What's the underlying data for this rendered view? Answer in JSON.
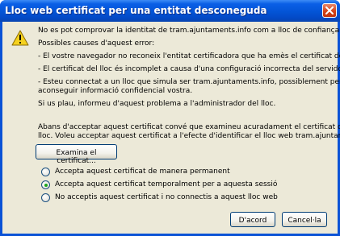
{
  "window": {
    "title": "Lloc web certificat per una entitat desconeguda"
  },
  "message": {
    "line1": "No es pot comprovar la identitat de tram.ajuntaments.info com a lloc de confiança.",
    "causes_heading": "Possibles causes d'aquest error:",
    "cause1": "- El vostre navegador no reconeix l'entitat certificadora que ha emès el certificat del lloc.",
    "cause2": "- El certificat del lloc és incomplet a causa d'una configuració incorrecta del servidor.",
    "cause3_line1": "- Esteu connectat a un lloc que simula ser tram.ajuntaments.info, possiblement per a",
    "cause3_line2": "aconseguir informació confidencial vostra.",
    "report": "Si us plau, informeu d'aquest problema a l'administrador del lloc.",
    "advice_line1": "Abans d'acceptar aquest certificat convé que examineu acuradament el certificat d'aquest",
    "advice_line2": "lloc. Voleu acceptar aquest certificat a l'efecte d'identificar el lloc web tram.ajuntaments.info?"
  },
  "examine_button": "Examina el certificat...",
  "options": [
    {
      "label": "Accepta aquest certificat de manera permanent",
      "selected": false
    },
    {
      "label": "Accepta aquest certificat temporalment per a aquesta sessió",
      "selected": true
    },
    {
      "label": "No acceptis aquest certificat i no connectis a aquest lloc web",
      "selected": false
    }
  ],
  "buttons": {
    "ok": "D'acord",
    "cancel": "Cancel·la"
  },
  "icons": {
    "warning": "warning-icon",
    "close": "close-icon"
  },
  "colors": {
    "titlebar": "#0354d6",
    "dialog_bg": "#ece9d8",
    "close_button": "#d5441a",
    "radio_selected": "#1ea51e"
  }
}
